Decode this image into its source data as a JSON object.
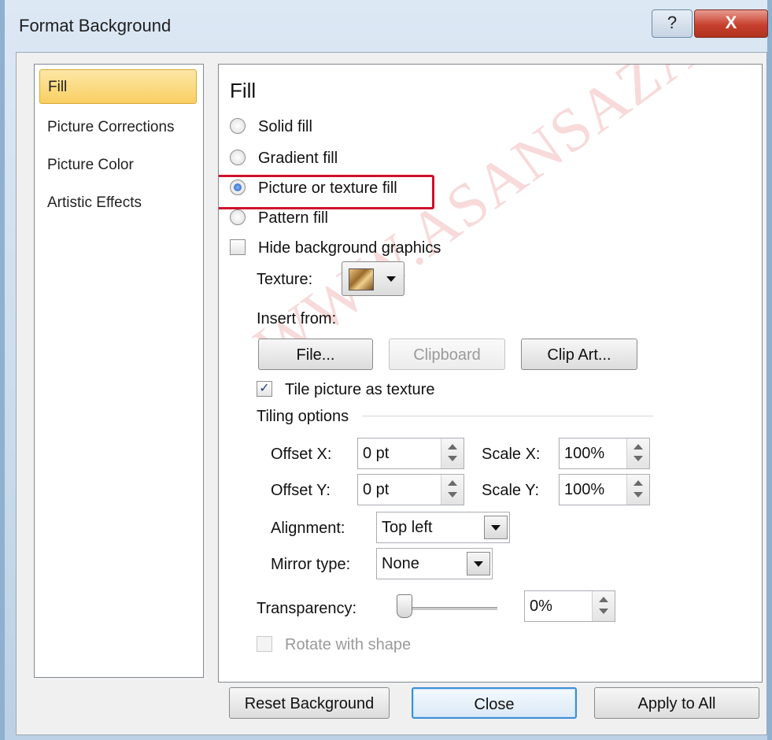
{
  "window": {
    "title": "Format Background",
    "help_label": "?",
    "close_label": "X"
  },
  "nav": {
    "items": [
      {
        "label": "Fill"
      },
      {
        "label": "Picture Corrections"
      },
      {
        "label": "Picture Color"
      },
      {
        "label": "Artistic Effects"
      }
    ],
    "selected": "Fill"
  },
  "panel": {
    "header": "Fill",
    "fill_options": [
      {
        "label": "Solid fill",
        "selected": false
      },
      {
        "label": "Gradient fill",
        "selected": false
      },
      {
        "label": "Picture or texture fill",
        "selected": true
      },
      {
        "label": "Pattern fill",
        "selected": false
      }
    ],
    "hide_bg_graphics": {
      "label": "Hide background graphics",
      "checked": false
    },
    "texture_label": "Texture:",
    "insert_from_label": "Insert from:",
    "buttons": {
      "file": "File...",
      "clipboard": "Clipboard",
      "clip_art": "Clip Art..."
    },
    "tile_checkbox": {
      "label": "Tile picture as texture",
      "checked": true
    },
    "tiling_options_label": "Tiling options",
    "offset_x": {
      "label": "Offset X:",
      "value": "0 pt"
    },
    "offset_y": {
      "label": "Offset Y:",
      "value": "0 pt"
    },
    "scale_x": {
      "label": "Scale X:",
      "value": "100%"
    },
    "scale_y": {
      "label": "Scale Y:",
      "value": "100%"
    },
    "alignment": {
      "label": "Alignment:",
      "value": "Top left"
    },
    "mirror_type": {
      "label": "Mirror type:",
      "value": "None"
    },
    "transparency": {
      "label": "Transparency:",
      "value": "0%",
      "level": 0
    },
    "rotate_with_shape": {
      "label": "Rotate with shape",
      "checked": false,
      "disabled": true
    }
  },
  "footer": {
    "reset": "Reset Background",
    "close": "Close",
    "apply_all": "Apply to All"
  },
  "watermark": "WWW.ASANSAZAN.COM",
  "highlight_color": "#d0102c"
}
